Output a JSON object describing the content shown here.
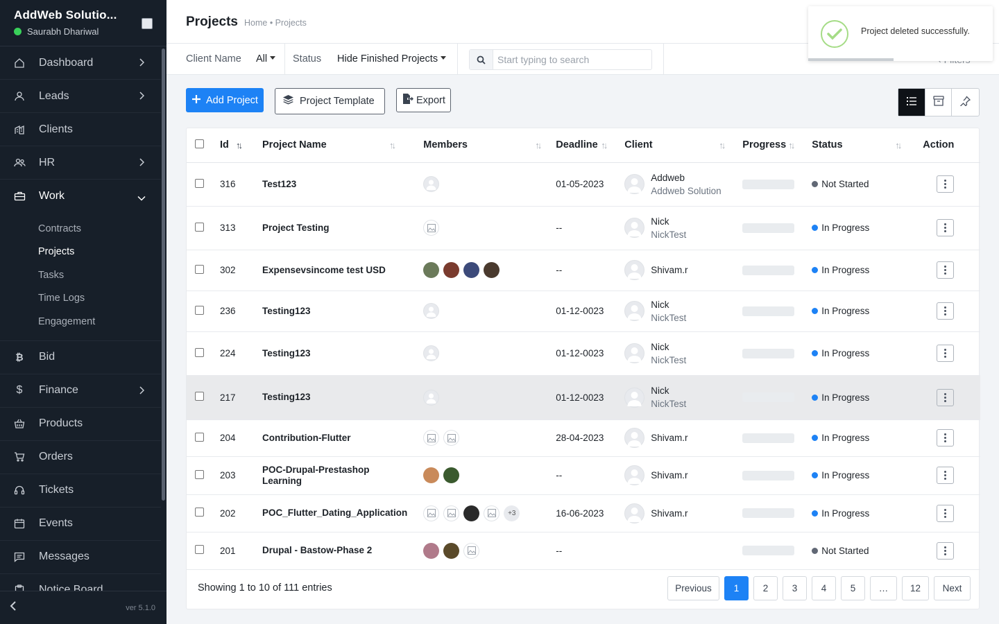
{
  "sidebar": {
    "company": "AddWeb Solutio...",
    "user": "Saurabh Dhariwal",
    "version": "ver 5.1.0",
    "items": [
      {
        "label": "Dashboard",
        "icon": "home-icon"
      },
      {
        "label": "Leads",
        "icon": "user-icon"
      },
      {
        "label": "Clients",
        "icon": "building-icon"
      },
      {
        "label": "HR",
        "icon": "users-icon"
      },
      {
        "label": "Work",
        "icon": "briefcase-icon"
      },
      {
        "label": "Bid",
        "icon": "bitcoin-icon"
      },
      {
        "label": "Finance",
        "icon": "dollar-icon"
      },
      {
        "label": "Products",
        "icon": "basket-icon"
      },
      {
        "label": "Orders",
        "icon": "cart-icon"
      },
      {
        "label": "Tickets",
        "icon": "headset-icon"
      },
      {
        "label": "Events",
        "icon": "calendar-icon"
      },
      {
        "label": "Messages",
        "icon": "message-icon"
      },
      {
        "label": "Notice Board",
        "icon": "clipboard-icon"
      }
    ],
    "work_sub": [
      "Contracts",
      "Projects",
      "Tasks",
      "Time Logs",
      "Engagement"
    ]
  },
  "header": {
    "title": "Projects",
    "breadcrumb": "Home • Projects"
  },
  "filters": {
    "client_label": "Client Name",
    "client_value": "All",
    "status_label": "Status",
    "status_value": "Hide Finished Projects",
    "search_placeholder": "Start typing to search",
    "filters_label": "Filters"
  },
  "actions": {
    "add": "Add Project",
    "template": "Project Template",
    "export": "Export"
  },
  "table": {
    "columns": [
      "Id",
      "Project Name",
      "Members",
      "Deadline",
      "Client",
      "Progress",
      "Status",
      "Action"
    ],
    "rows": [
      {
        "id": "316",
        "name": "Test123",
        "deadline": "01-05-2023",
        "client": "Addweb",
        "client_sub": "Addweb Solution",
        "status": "Not Started"
      },
      {
        "id": "313",
        "name": "Project Testing",
        "deadline": "--",
        "client": "Nick",
        "client_sub": "NickTest",
        "status": "In Progress"
      },
      {
        "id": "302",
        "name": "Expensevsincome test USD",
        "deadline": "--",
        "client": "Shivam.r",
        "client_sub": "",
        "status": "In Progress"
      },
      {
        "id": "236",
        "name": "Testing123",
        "deadline": "01-12-0023",
        "client": "Nick",
        "client_sub": "NickTest",
        "status": "In Progress"
      },
      {
        "id": "224",
        "name": "Testing123",
        "deadline": "01-12-0023",
        "client": "Nick",
        "client_sub": "NickTest",
        "status": "In Progress"
      },
      {
        "id": "217",
        "name": "Testing123",
        "deadline": "01-12-0023",
        "client": "Nick",
        "client_sub": "NickTest",
        "status": "In Progress"
      },
      {
        "id": "204",
        "name": "Contribution-Flutter",
        "deadline": "28-04-2023",
        "client": "Shivam.r",
        "client_sub": "",
        "status": "In Progress"
      },
      {
        "id": "203",
        "name": "POC-Drupal-Prestashop Learning",
        "deadline": "--",
        "client": "Shivam.r",
        "client_sub": "",
        "status": "In Progress"
      },
      {
        "id": "202",
        "name": "POC_Flutter_Dating_Application",
        "deadline": "16-06-2023",
        "client": "Shivam.r",
        "client_sub": "",
        "status": "In Progress",
        "more_members": "+3"
      },
      {
        "id": "201",
        "name": "Drupal - Bastow-Phase 2",
        "deadline": "--",
        "client": "",
        "client_sub": "",
        "status": "Not Started"
      }
    ]
  },
  "footer": {
    "showing": "Showing 1 to 10 of 111 entries",
    "pages": [
      "Previous",
      "1",
      "2",
      "3",
      "4",
      "5",
      "…",
      "12",
      "Next"
    ]
  },
  "toast": {
    "message": "Project deleted successfully."
  },
  "colors": {
    "primary": "#1d82f5",
    "sidebar_bg": "#171f29",
    "status_in_progress": "#1d82f5",
    "status_not_started": "#616875",
    "online": "#39d05a",
    "success": "#a5dc86"
  }
}
